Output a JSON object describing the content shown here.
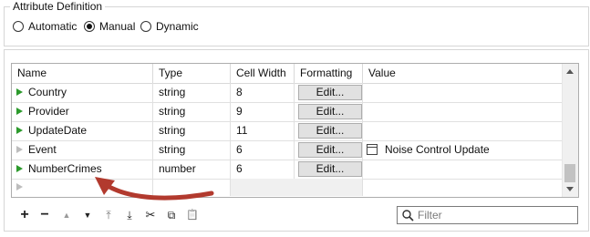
{
  "attribute_definition": {
    "legend": "Attribute Definition",
    "options": [
      {
        "label": "Automatic",
        "selected": false
      },
      {
        "label": "Manual",
        "selected": true
      },
      {
        "label": "Dynamic",
        "selected": false
      }
    ]
  },
  "table": {
    "columns": [
      "Name",
      "Type",
      "Cell Width",
      "Formatting",
      "Value"
    ],
    "rows": [
      {
        "name": "Country",
        "type": "string",
        "width": "8",
        "formatting": "Edit...",
        "value": ""
      },
      {
        "name": "Provider",
        "type": "string",
        "width": "9",
        "formatting": "Edit...",
        "value": ""
      },
      {
        "name": "UpdateDate",
        "type": "string",
        "width": "11",
        "formatting": "Edit...",
        "value": ""
      },
      {
        "name": "Event",
        "type": "string",
        "width": "6",
        "formatting": "Edit...",
        "value": "Noise Control Update"
      },
      {
        "name": "NumberCrimes",
        "type": "number",
        "width": "6",
        "formatting": "Edit...",
        "value": ""
      }
    ]
  },
  "toolbar": {
    "add": "+",
    "remove": "−",
    "move_up": "▲",
    "move_down": "▼",
    "move_top": "⤒",
    "move_bottom": "⤓",
    "cut": "✂",
    "copy": "⧉",
    "paste": "📋"
  },
  "filter": {
    "placeholder": "Filter"
  },
  "colors": {
    "arrow": "#b23a2e",
    "row_marker": "#2c9a2c"
  }
}
